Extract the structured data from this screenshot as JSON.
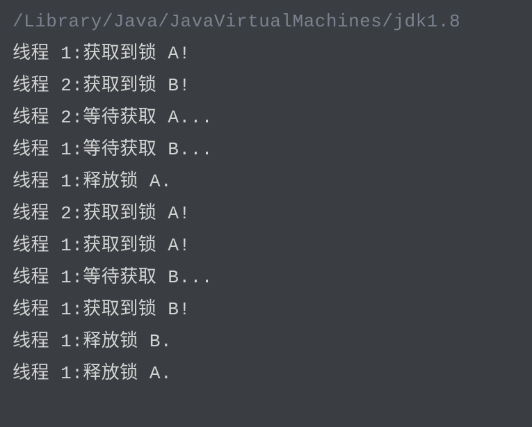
{
  "console": {
    "header": "/Library/Java/JavaVirtualMachines/jdk1.8",
    "lines": [
      "线程 1:获取到锁 A!",
      "线程 2:获取到锁 B!",
      "线程 2:等待获取 A...",
      "线程 1:等待获取 B...",
      "线程 1:释放锁 A.",
      "线程 2:获取到锁 A!",
      "线程 1:获取到锁 A!",
      "线程 1:等待获取 B...",
      "线程 1:获取到锁 B!",
      "线程 1:释放锁 B.",
      "线程 1:释放锁 A."
    ]
  }
}
